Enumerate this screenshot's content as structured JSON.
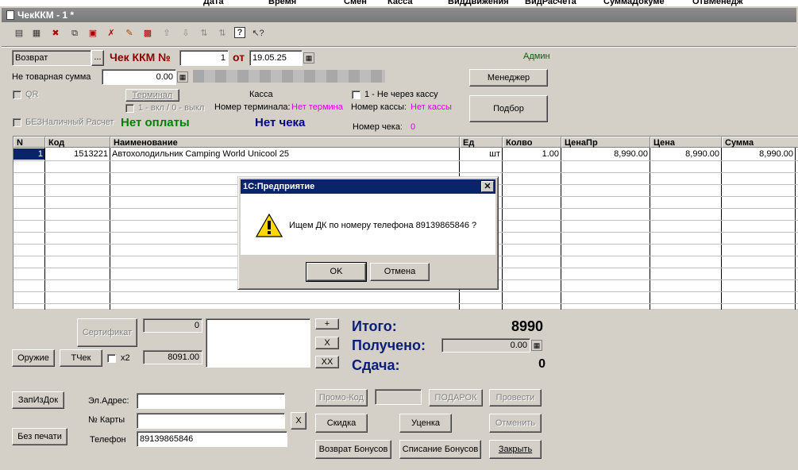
{
  "background_headers": [
    "Дата",
    "Время",
    "Смен",
    "Касса",
    "ВидДвижения",
    "ВидРасчета",
    "СуммаДокуме",
    "ОтвМенедж"
  ],
  "window": {
    "title": "ЧекККМ - 1 *"
  },
  "toolbar": {
    "icons": [
      "new-doc-icon",
      "copy-doc-icon",
      "delete-doc-icon",
      "duplicate-icon",
      "export-icon",
      "delete-row-icon",
      "edit-icon",
      "properties-icon",
      "move-up-icon",
      "move-down-icon",
      "sort-asc-icon",
      "sort-desc-icon",
      "help-icon",
      "pointer-help-icon"
    ]
  },
  "header": {
    "operation": "Возврат",
    "title_label": "Чек ККМ №",
    "number": "1",
    "from_label": "от",
    "date": "19.05.25",
    "user": "Админ",
    "non_goods_label": "Не товарная сумма",
    "non_goods_value": "0.00",
    "manager_btn": "Менеджер",
    "podbor_btn": "Подбор",
    "qr_label": "QR",
    "terminal_btn": "Терминал",
    "terminal_toggle_label": "1 - вкл / 0 - выкл",
    "kassa_label": "Касса",
    "terminal_number_label": "Номер терминала:",
    "terminal_number_value": "Нет термина",
    "not_via_kassa_label": "1 - Не через кассу",
    "kassa_number_label": "Номер кассы:",
    "kassa_number_value": "Нет кассы",
    "cashless_label": "БЕЗНаличный Расчет",
    "no_payment": "Нет оплаты",
    "no_check": "Нет чека",
    "check_number_label": "Номер чека:",
    "check_number_value": "0"
  },
  "table": {
    "columns": [
      "N",
      "Код",
      "Наименование",
      "Ед",
      "Колво",
      "ЦенаПр",
      "Цена",
      "Сумма"
    ],
    "rows": [
      {
        "n": "1",
        "code": "1513221",
        "name": "Автохолодильник Camping World Unicool 25",
        "unit": "шт",
        "qty": "1.00",
        "price_pr": "8,990.00",
        "price": "8,990.00",
        "sum": "8,990.00"
      }
    ]
  },
  "dialog": {
    "title": "1С:Предприятие",
    "message": "Ищем ДК по номеру телефона 89139865846 ?",
    "ok": "OK",
    "cancel": "Отмена"
  },
  "bottom": {
    "certificate_btn": "Сертификат",
    "certificate_value": "0",
    "weapon_btn": "Оружие",
    "tcheck_btn": "ТЧек",
    "x2_label": "x2",
    "amount_value": "8091.00",
    "plus_btn": "+",
    "x_btn": "X",
    "xx_btn": "XX",
    "total_label": "Итого:",
    "total_value": "8990",
    "received_label": "Получено:",
    "received_value": "0.00",
    "change_label": "Сдача:",
    "change_value": "0",
    "zapizdok_btn": "ЗапИзДок",
    "noprint_btn": "Без печати",
    "email_label": "Эл.Адрес:",
    "card_label": "№ Карты",
    "phone_label": "Телефон",
    "phone_value": "89139865846",
    "card_clear_btn": "X",
    "promo_btn": "Промо-Код",
    "gift_btn": "ПОДАРОК",
    "post_btn": "Провести",
    "discount_btn": "Скидка",
    "markdown_btn": "Уценка",
    "cancel_btn": "Отменить",
    "return_bonus_btn": "Возврат Бонусов",
    "spend_bonus_btn": "Списание Бонусов",
    "close_btn": "Закрыть"
  }
}
